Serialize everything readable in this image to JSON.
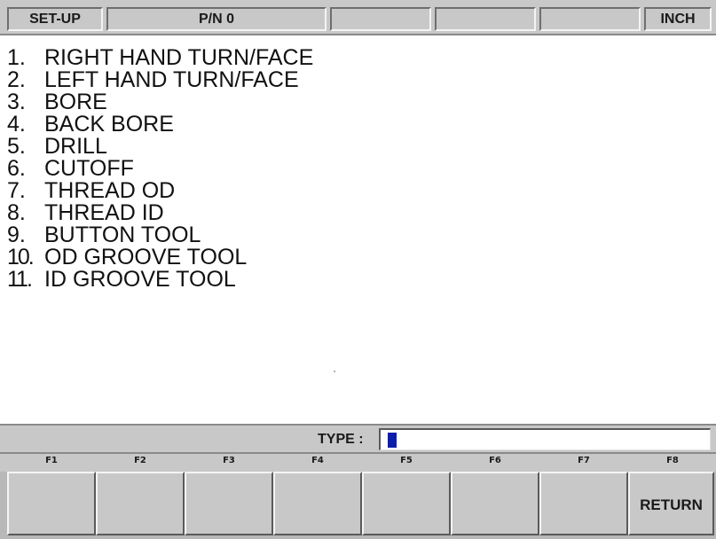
{
  "header": {
    "mode": "SET-UP",
    "part_number": "P/N 0",
    "field3": "",
    "field4": "",
    "field5": "",
    "units": "INCH"
  },
  "tool_menu": {
    "items": [
      {
        "num": "1.",
        "label": "RIGHT HAND TURN/FACE"
      },
      {
        "num": "2.",
        "label": "LEFT HAND TURN/FACE"
      },
      {
        "num": "3.",
        "label": "BORE"
      },
      {
        "num": "4.",
        "label": "BACK BORE"
      },
      {
        "num": "5.",
        "label": "DRILL"
      },
      {
        "num": "6.",
        "label": "CUTOFF"
      },
      {
        "num": "7.",
        "label": "THREAD OD"
      },
      {
        "num": "8.",
        "label": "THREAD ID"
      },
      {
        "num": "9.",
        "label": "BUTTON TOOL"
      },
      {
        "num": "10.",
        "label": "OD GROOVE TOOL"
      },
      {
        "num": "11.",
        "label": "ID GROOVE TOOL"
      }
    ]
  },
  "type_row": {
    "label": "TYPE :",
    "value": ""
  },
  "function_keys": {
    "labels": [
      "F1",
      "F2",
      "F3",
      "F4",
      "F5",
      "F6",
      "F7",
      "F8"
    ],
    "buttons": [
      "",
      "",
      "",
      "",
      "",
      "",
      "",
      "RETURN"
    ]
  },
  "colors": {
    "panel": "#c8c8c8",
    "cursor": "#0a1ea8",
    "background": "#ffffff"
  }
}
